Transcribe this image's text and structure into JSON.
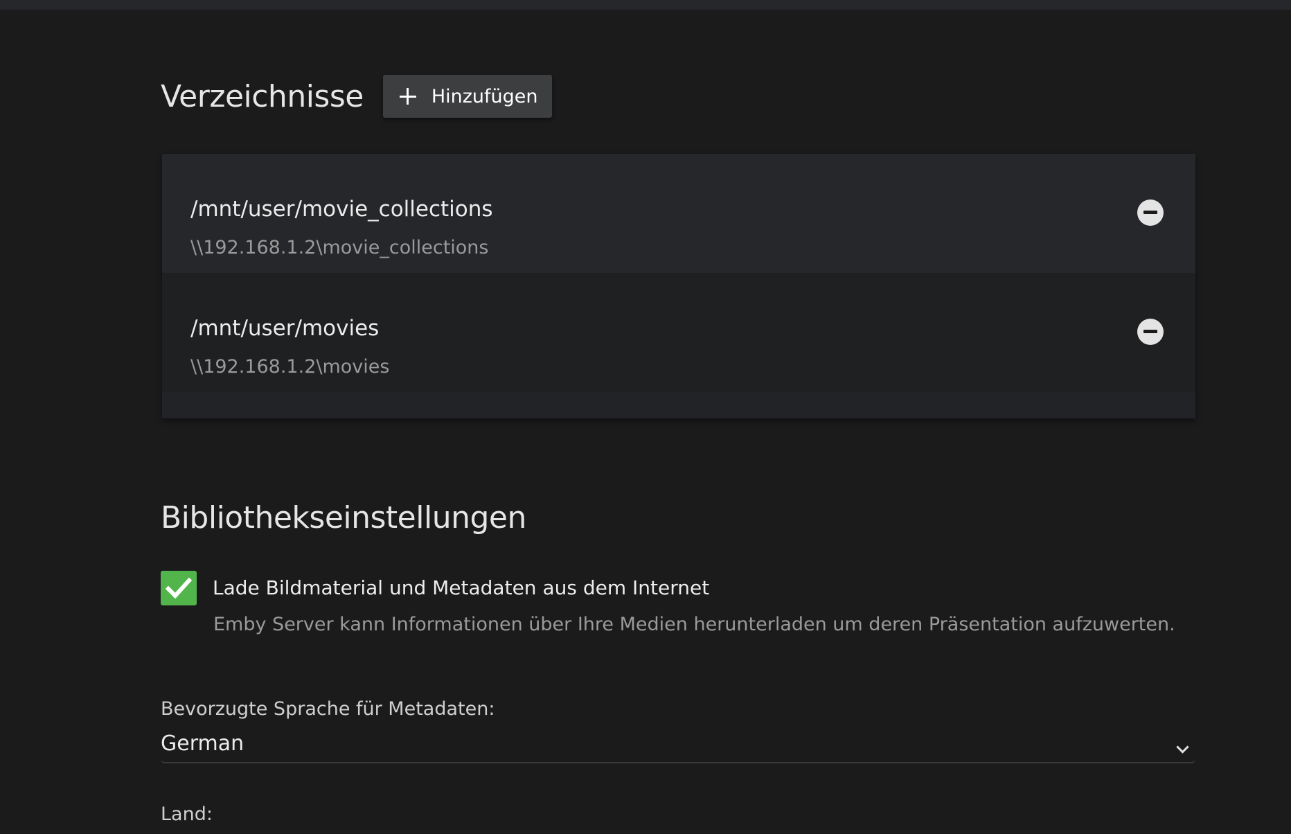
{
  "directories": {
    "title": "Verzeichnisse",
    "add_label": "Hinzufügen",
    "items": [
      {
        "path": "/mnt/user/movie_collections",
        "network_path": "\\\\192.168.1.2\\movie_collections"
      },
      {
        "path": "/mnt/user/movies",
        "network_path": "\\\\192.168.1.2\\movies"
      }
    ]
  },
  "library_settings": {
    "title": "Bibliothekseinstellungen",
    "download_metadata": {
      "label": "Lade Bildmaterial und Metadaten aus dem Internet",
      "description": "Emby Server kann Informationen über Ihre Medien herunterladen um deren Präsentation aufzuwerten.",
      "checked": true
    },
    "preferred_language": {
      "label": "Bevorzugte Sprache für Metadaten:",
      "value": "German"
    },
    "country": {
      "label": "Land:"
    }
  },
  "colors": {
    "background": "#1b1b1c",
    "checkbox_accent": "#52b54b"
  },
  "icons": {
    "add": "plus-icon",
    "remove": "minus-circle-icon",
    "checkbox": "check-icon",
    "select": "chevron-down-icon"
  }
}
